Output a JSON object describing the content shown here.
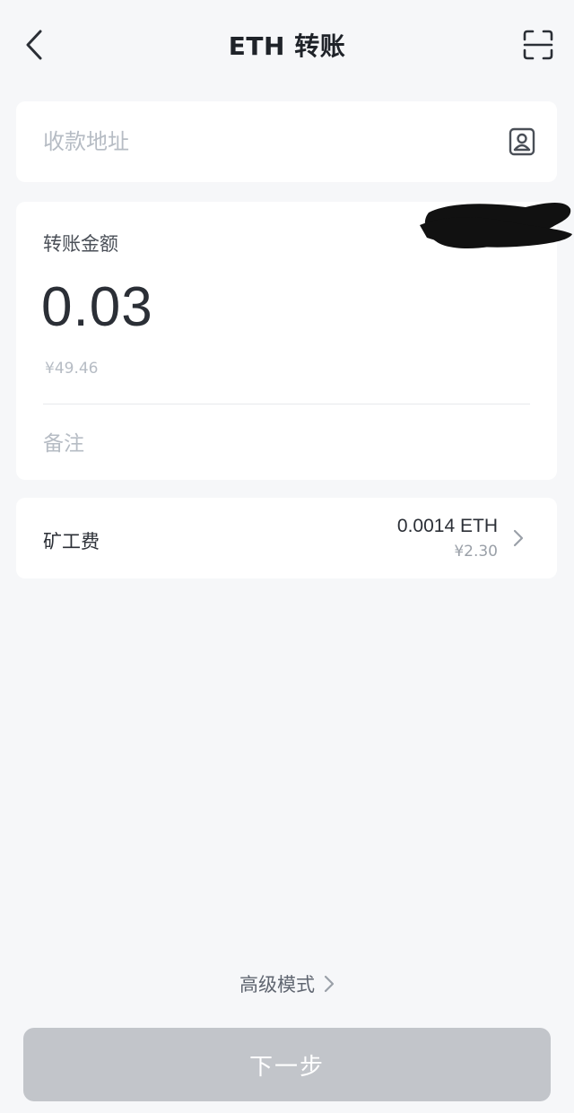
{
  "header": {
    "title": "ETH 转账",
    "back_icon": "chevron-left-icon",
    "scan_icon": "scan-icon"
  },
  "address": {
    "placeholder": "收款地址",
    "value": "",
    "contact_icon": "address-book-icon"
  },
  "amount": {
    "label": "转账金额",
    "value": "0.03",
    "fiat": "¥49.46",
    "memo_placeholder": "备注",
    "memo_value": ""
  },
  "fee": {
    "label": "矿工费",
    "amount": "0.0014 ETH",
    "fiat": "¥2.30",
    "chevron_icon": "chevron-right-icon"
  },
  "advanced": {
    "label": "高级模式",
    "chevron_icon": "chevron-right-icon"
  },
  "next_button": {
    "label": "下一步"
  },
  "colors": {
    "background": "#f6f7f9",
    "card": "#ffffff",
    "button_disabled": "#c2c5ca",
    "placeholder": "#b6bcc4"
  }
}
